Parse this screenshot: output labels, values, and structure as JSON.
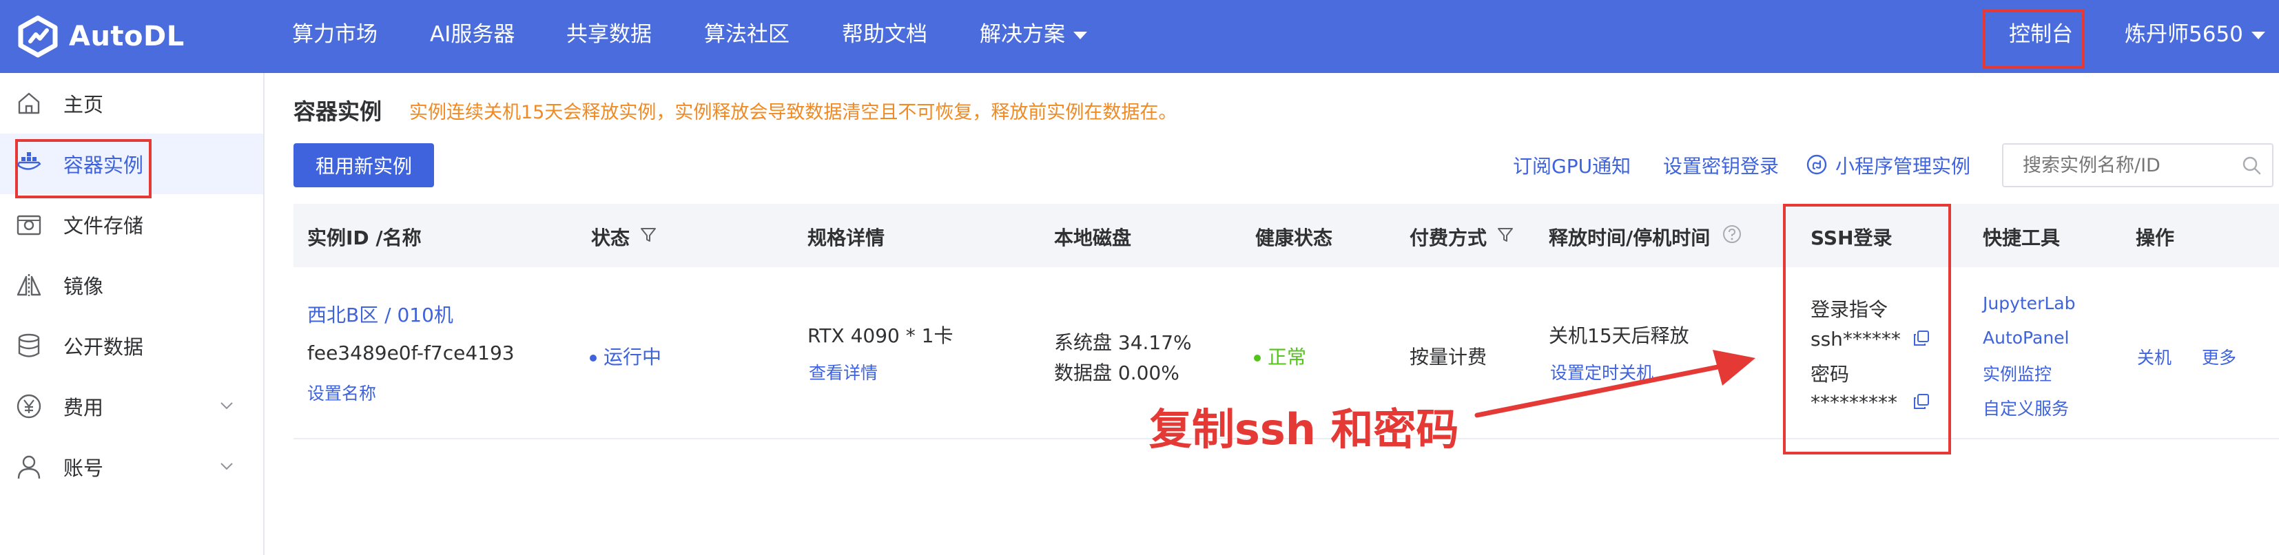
{
  "brand": {
    "name": "AutoDL"
  },
  "nav": {
    "items": [
      "算力市场",
      "AI服务器",
      "共享数据",
      "算法社区",
      "帮助文档"
    ],
    "solutions": "解决方案",
    "console": "控制台",
    "user": "炼丹师5650"
  },
  "sidebar": {
    "items": [
      {
        "label": "主页",
        "icon": "home-icon"
      },
      {
        "label": "容器实例",
        "icon": "container-icon"
      },
      {
        "label": "文件存储",
        "icon": "storage-icon"
      },
      {
        "label": "镜像",
        "icon": "image-icon"
      },
      {
        "label": "公开数据",
        "icon": "database-icon"
      },
      {
        "label": "费用",
        "icon": "yen-icon"
      },
      {
        "label": "账号",
        "icon": "user-icon"
      }
    ]
  },
  "page": {
    "title": "容器实例",
    "notice": "实例连续关机15天会释放实例，实例释放会导致数据清空且不可恢复，释放前实例在数据在。"
  },
  "toolbar": {
    "rent_button": "租用新实例",
    "gpu_notify": "订阅GPU通知",
    "key_login": "设置密钥登录",
    "miniprogram": "小程序管理实例",
    "search_placeholder": "搜索实例名称/ID"
  },
  "table": {
    "headers": {
      "instance": "实例ID /名称",
      "status": "状态",
      "spec": "规格详情",
      "disk": "本地磁盘",
      "health": "健康状态",
      "billing": "付费方式",
      "release": "释放时间/停机时间",
      "ssh": "SSH登录",
      "tools": "快捷工具",
      "ops": "操作"
    },
    "row": {
      "region": "西北B区 / 010机",
      "id": "fee3489e0f-f7ce4193",
      "set_name": "设置名称",
      "status": "运行中",
      "gpu": "RTX 4090 * 1卡",
      "view_details": "查看详情",
      "system_disk": "系统盘 34.17%",
      "data_disk": "数据盘 0.00%",
      "health": "正常",
      "billing": "按量计费",
      "release": "关机15天后释放",
      "schedule_shutdown": "设置定时关机",
      "ssh_cmd_label": "登录指令",
      "ssh_cmd": "ssh******",
      "pwd_label": "密码",
      "pwd": "*********",
      "tools": [
        "JupyterLab",
        "AutoPanel",
        "实例监控",
        "自定义服务"
      ],
      "shutdown": "关机",
      "more": "更多"
    }
  },
  "annotation": {
    "text": "复制ssh 和密码"
  },
  "colors": {
    "brand": "#4a6cdc",
    "primary": "#3e63dd",
    "warning": "#f08a24",
    "success": "#52c41a",
    "annotation": "#e53935"
  }
}
